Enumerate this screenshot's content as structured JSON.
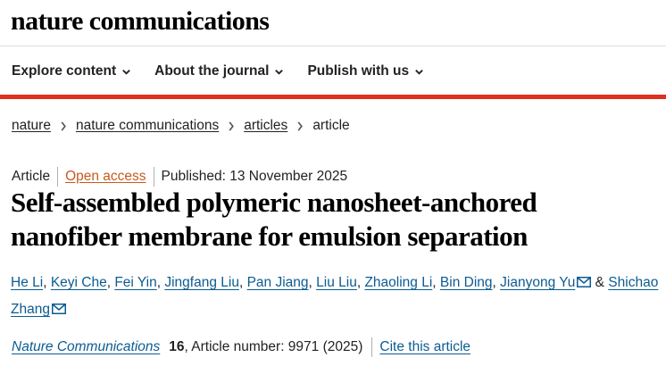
{
  "header": {
    "brand": "nature communications"
  },
  "nav": {
    "items": [
      {
        "label": "Explore content"
      },
      {
        "label": "About the journal"
      },
      {
        "label": "Publish with us"
      }
    ]
  },
  "breadcrumb": {
    "items": [
      "nature",
      "nature communications",
      "articles"
    ],
    "current": "article"
  },
  "article": {
    "type": "Article",
    "access": "Open access",
    "published": "Published: 13 November 2025",
    "title": "Self-assembled polymeric nanosheet-anchored nanofiber membrane for emulsion separation",
    "authors": [
      {
        "name": "He Li"
      },
      {
        "name": "Keyi Che"
      },
      {
        "name": "Fei Yin"
      },
      {
        "name": "Jingfang Liu"
      },
      {
        "name": "Pan Jiang"
      },
      {
        "name": "Liu Liu"
      },
      {
        "name": "Zhaoling Li"
      },
      {
        "name": "Bin Ding"
      },
      {
        "name": "Jianyong Yu"
      },
      {
        "name": "Shichao Zhang"
      }
    ],
    "author_joiner": "&",
    "journal": "Nature Communications",
    "volume": "16",
    "article_number": ", Article number: 9971 (2025)",
    "cite_label": "Cite this article"
  },
  "colors": {
    "accent_red": "#e0301e",
    "link_blue": "#0b5c92",
    "open_access_orange": "#c85a1e"
  },
  "icons": {
    "nav_chevron": "chevron-down-icon",
    "breadcrumb_separator": "chevron-right-icon",
    "corresponding_author": "mail-icon"
  }
}
